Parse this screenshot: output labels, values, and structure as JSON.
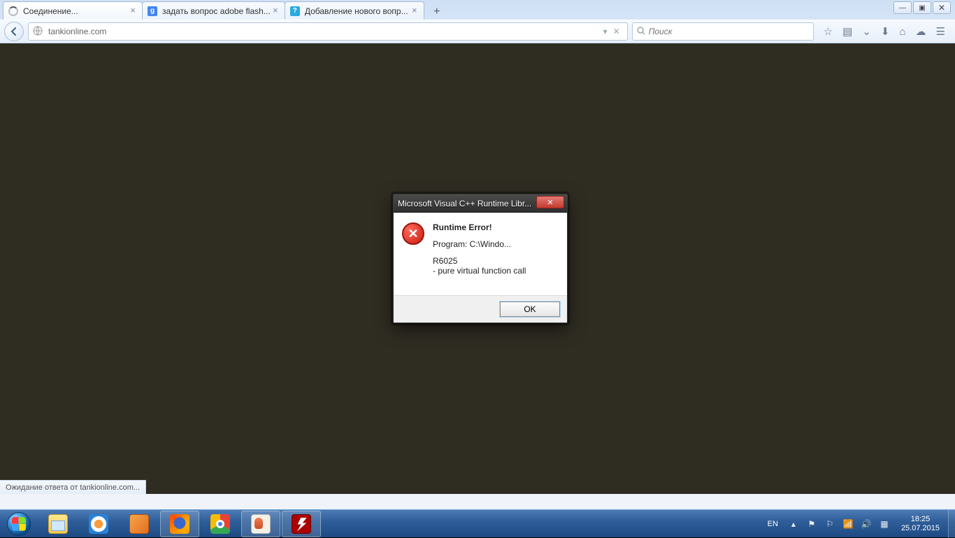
{
  "window_controls": {
    "minimize": "—",
    "maximize": "▣",
    "close": "✕"
  },
  "tabs": [
    {
      "title": "Соединение...",
      "favicon": "spinner"
    },
    {
      "title": "задать вопрос adobe flash...",
      "favicon": "google"
    },
    {
      "title": "Добавление нового вопр...",
      "favicon": "question"
    }
  ],
  "navbar": {
    "url": "tankionline.com",
    "search_placeholder": "Поиск"
  },
  "status_text": "Ожидание ответа от tankionline.com...",
  "dialog": {
    "title": "Microsoft Visual C++ Runtime Libr...",
    "heading": "Runtime Error!",
    "program_line": "Program: C:\\Windo...",
    "code": "R6025",
    "detail": "- pure virtual function call",
    "ok": "OK"
  },
  "tray": {
    "lang": "EN",
    "time": "18:25",
    "date": "25.07.2015"
  }
}
